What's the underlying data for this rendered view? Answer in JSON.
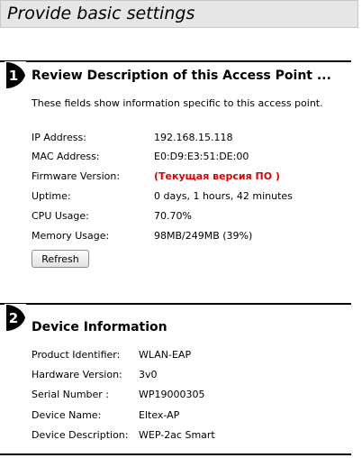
{
  "header": {
    "title": "Provide basic settings"
  },
  "access_point": {
    "step": "1",
    "title": "Review Description of this Access Point ...",
    "intro": "These fields show information specific to this access point.",
    "ip_label": "IP Address:",
    "ip_value": "192.168.15.118",
    "mac_label": "MAC Address:",
    "mac_value": "E0:D9:E3:51:DE:00",
    "fw_label": "Firmware Version:",
    "fw_value": "(Текущая версия ПО )",
    "uptime_label": "Uptime:",
    "uptime_value": "0 days, 1 hours, 42 minutes",
    "cpu_label": "CPU Usage:",
    "cpu_value": "70.70%",
    "mem_label": "Memory Usage:",
    "mem_value": "98MB/249MB (39%)",
    "refresh_label": "Refresh"
  },
  "device_info": {
    "step": "2",
    "title": "Device Information",
    "product_label": "Product Identifier:",
    "product_value": "WLAN-EAP",
    "hw_label": "Hardware Version:",
    "hw_value": "3v0",
    "serial_label": "Serial Number :",
    "serial_value": "WP19000305",
    "name_label": "Device Name:",
    "name_value": "Eltex-AP",
    "desc_label": "Device Description:",
    "desc_value": "WEP-2ac Smart"
  },
  "colors": {
    "warning": "#e00000",
    "header_bg": "#e6e6e6"
  },
  "icons": {
    "step_badge": "step-number-badge"
  }
}
